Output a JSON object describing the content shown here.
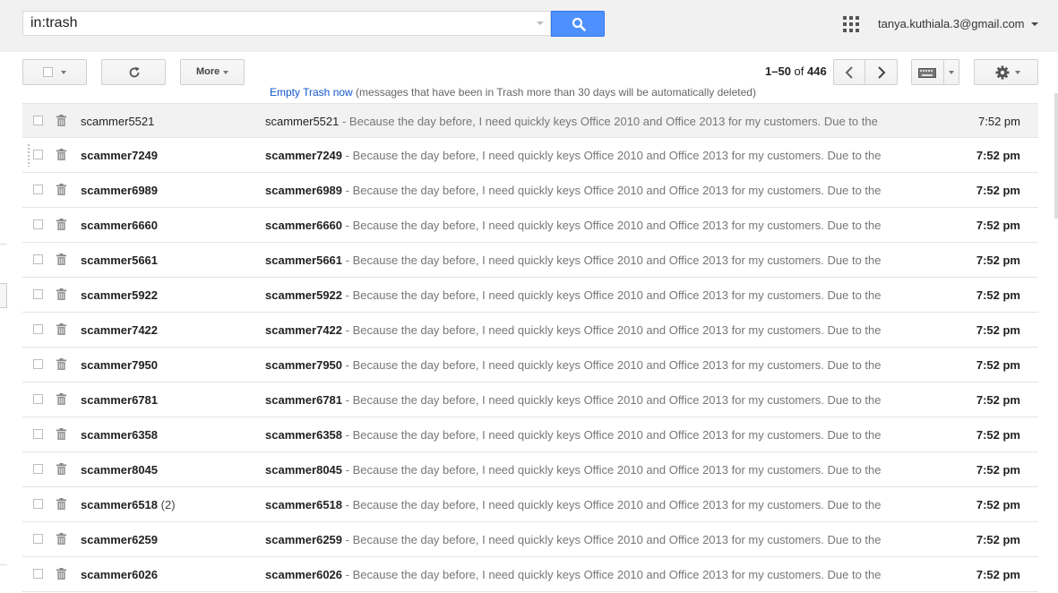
{
  "search": {
    "value": "in:trash"
  },
  "account": {
    "email": "tanya.kuthiala.3@gmail.com"
  },
  "toolbar": {
    "more_label": "More"
  },
  "pager": {
    "range": "1–50",
    "of": "of",
    "total": "446"
  },
  "notice": {
    "link": "Empty Trash now",
    "text": " (messages that have been in Trash more than 30 days will be automatically deleted)"
  },
  "snippet": " - Because the day before, I need quickly keys Office 2010 and Office 2013 for my customers. Due to the",
  "emails": [
    {
      "sender": "scammer5521",
      "count": "",
      "subject": "scammer5521",
      "time": "7:52 pm",
      "unread": false
    },
    {
      "sender": "scammer7249",
      "count": "",
      "subject": "scammer7249",
      "time": "7:52 pm",
      "unread": true
    },
    {
      "sender": "scammer6989",
      "count": "",
      "subject": "scammer6989",
      "time": "7:52 pm",
      "unread": true
    },
    {
      "sender": "scammer6660",
      "count": "",
      "subject": "scammer6660",
      "time": "7:52 pm",
      "unread": true
    },
    {
      "sender": "scammer5661",
      "count": "",
      "subject": "scammer5661",
      "time": "7:52 pm",
      "unread": true
    },
    {
      "sender": "scammer5922",
      "count": "",
      "subject": "scammer5922",
      "time": "7:52 pm",
      "unread": true
    },
    {
      "sender": "scammer7422",
      "count": "",
      "subject": "scammer7422",
      "time": "7:52 pm",
      "unread": true
    },
    {
      "sender": "scammer7950",
      "count": "",
      "subject": "scammer7950",
      "time": "7:52 pm",
      "unread": true
    },
    {
      "sender": "scammer6781",
      "count": "",
      "subject": "scammer6781",
      "time": "7:52 pm",
      "unread": true
    },
    {
      "sender": "scammer6358",
      "count": "",
      "subject": "scammer6358",
      "time": "7:52 pm",
      "unread": true
    },
    {
      "sender": "scammer8045",
      "count": "",
      "subject": "scammer8045",
      "time": "7:52 pm",
      "unread": true
    },
    {
      "sender": "scammer6518",
      "count": "(2)",
      "subject": "scammer6518",
      "time": "7:52 pm",
      "unread": true
    },
    {
      "sender": "scammer6259",
      "count": "",
      "subject": "scammer6259",
      "time": "7:52 pm",
      "unread": true
    },
    {
      "sender": "scammer6026",
      "count": "",
      "subject": "scammer6026",
      "time": "7:52 pm",
      "unread": true
    }
  ]
}
